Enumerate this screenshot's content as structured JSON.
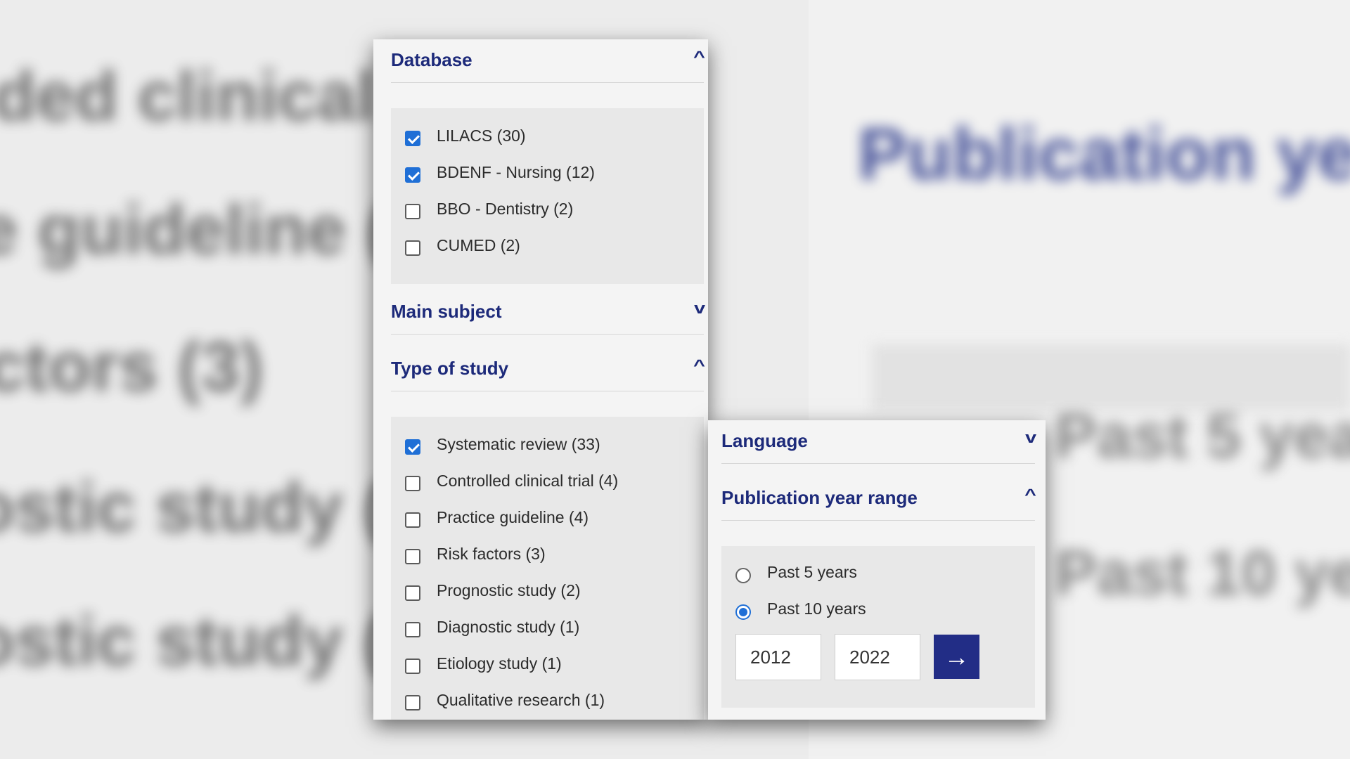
{
  "background": {
    "left_lines": [
      "ded clinical tr",
      "e guideline (4",
      "ctors (3)",
      "ostic study (2",
      "ostic study (1"
    ],
    "right_lines": [
      "Publication ye",
      "Past 5 years",
      "Past 10 years"
    ]
  },
  "left_panel": {
    "database": {
      "title": "Database",
      "chevron": "up",
      "items": [
        {
          "label": "LILACS (30)",
          "checked": true
        },
        {
          "label": "BDENF - Nursing (12)",
          "checked": true
        },
        {
          "label": "BBO - Dentistry (2)",
          "checked": false
        },
        {
          "label": "CUMED (2)",
          "checked": false
        }
      ]
    },
    "main_subject": {
      "title": "Main subject",
      "chevron": "down"
    },
    "type_of_study": {
      "title": "Type of study",
      "chevron": "up",
      "items": [
        {
          "label": "Systematic review (33)",
          "checked": true
        },
        {
          "label": "Controlled clinical trial (4)",
          "checked": false
        },
        {
          "label": "Practice guideline (4)",
          "checked": false
        },
        {
          "label": "Risk factors (3)",
          "checked": false
        },
        {
          "label": "Prognostic study (2)",
          "checked": false
        },
        {
          "label": "Diagnostic study (1)",
          "checked": false
        },
        {
          "label": "Etiology study (1)",
          "checked": false
        },
        {
          "label": "Qualitative research (1)",
          "checked": false
        }
      ]
    }
  },
  "right_panel": {
    "language": {
      "title": "Language",
      "chevron": "down"
    },
    "publication_year_range": {
      "title": "Publication year range",
      "chevron": "up",
      "options": [
        {
          "label": "Past 5 years",
          "selected": false
        },
        {
          "label": "Past 10 years",
          "selected": true
        }
      ],
      "from_year": "2012",
      "to_year": "2022",
      "submit_icon": "arrow-right-icon"
    }
  },
  "colors": {
    "heading": "#1d2a7a",
    "accent": "#1f6fd6",
    "button": "#222d86"
  }
}
